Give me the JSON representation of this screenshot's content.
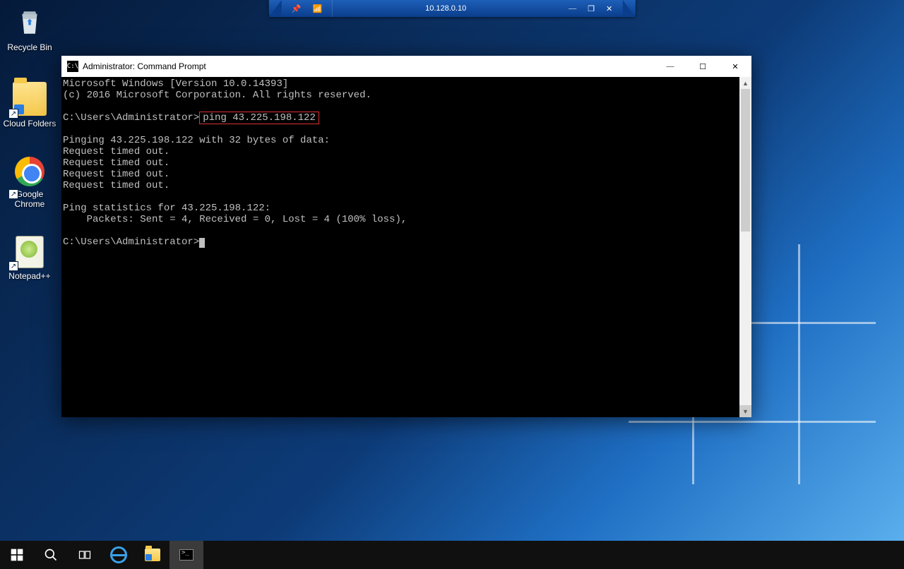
{
  "session_bar": {
    "ip": "10.128.0.10"
  },
  "desktop_icons": {
    "recycle": "Recycle Bin",
    "cloud_folders": "Cloud Folders",
    "chrome": "Google\nChrome",
    "notepadpp": "Notepad++"
  },
  "cmd_window": {
    "title": "Administrator: Command Prompt",
    "lines": {
      "l1": "Microsoft Windows [Version 10.0.14393]",
      "l2": "(c) 2016 Microsoft Corporation. All rights reserved.",
      "blank1": "",
      "prompt1_path": "C:\\Users\\Administrator>",
      "highlight_cmd": "ping 43.225.198.122",
      "blank2": "",
      "l3": "Pinging 43.225.198.122 with 32 bytes of data:",
      "l4": "Request timed out.",
      "l5": "Request timed out.",
      "l6": "Request timed out.",
      "l7": "Request timed out.",
      "blank3": "",
      "l8": "Ping statistics for 43.225.198.122:",
      "l9": "    Packets: Sent = 4, Received = 0, Lost = 4 (100% loss),",
      "blank4": "",
      "prompt2_path": "C:\\Users\\Administrator>"
    }
  }
}
